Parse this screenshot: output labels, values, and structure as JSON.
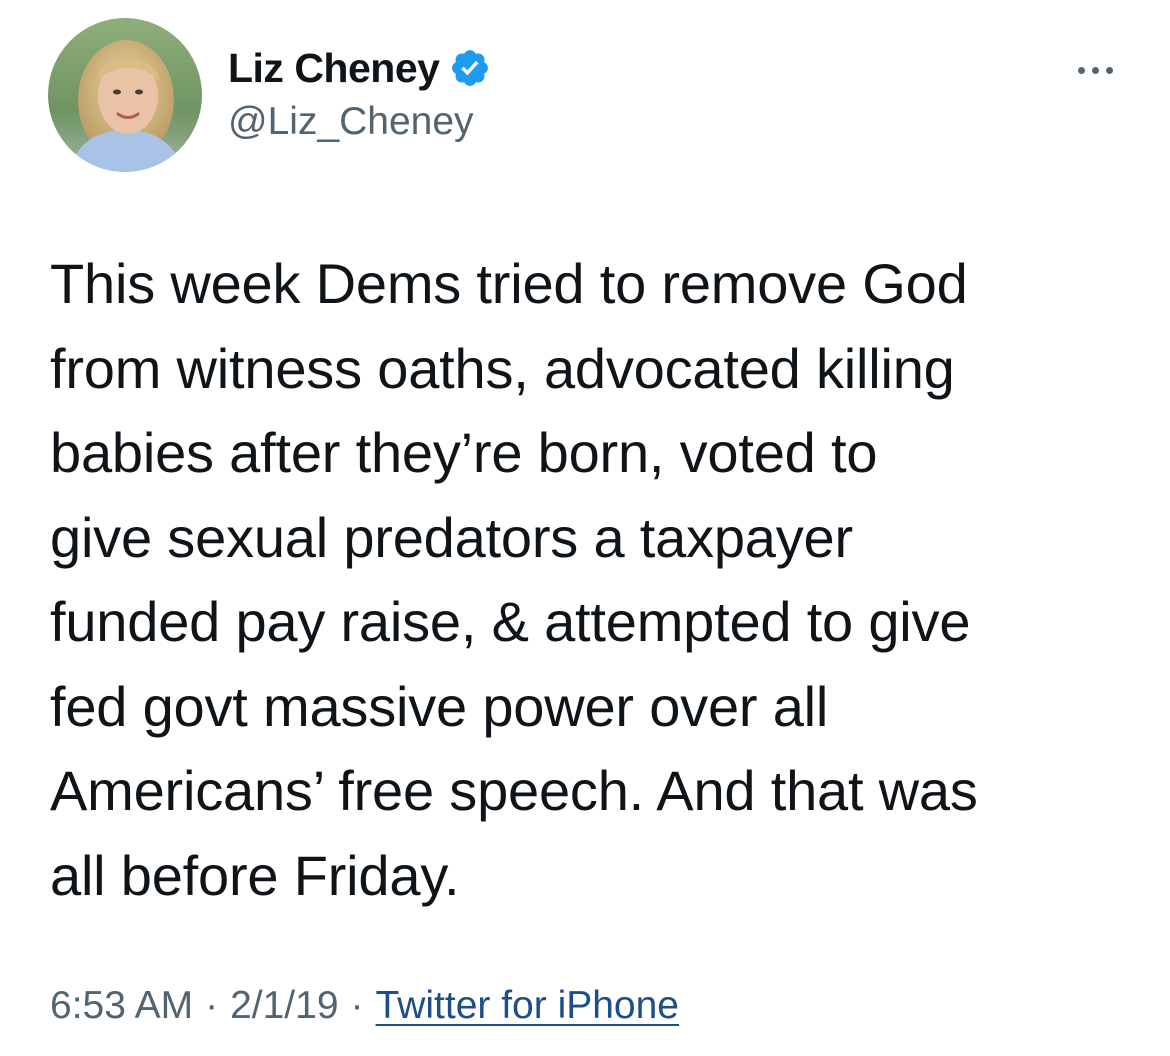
{
  "user": {
    "display_name": "Liz Cheney",
    "handle": "@Liz_Cheney",
    "verified": true,
    "avatar_icon": "profile-photo"
  },
  "tweet": {
    "text": "This week Dems tried to remove God\nfrom witness oaths, advocated killing\nbabies after they’re born, voted to\ngive sexual predators a taxpayer\nfunded pay raise, & attempted to give\nfed govt massive power over all\nAmericans’ free speech. And that was\nall before Friday.",
    "time": "6:53 AM",
    "date": "2/1/19",
    "separator": "·",
    "source": "Twitter for iPhone"
  },
  "icons": {
    "verified": "verified-badge-icon",
    "more": "more-options-icon"
  },
  "colors": {
    "text": "#0f1419",
    "secondary": "#536471",
    "verified_blue": "#1d9bf0",
    "link": "#1d4e89"
  }
}
